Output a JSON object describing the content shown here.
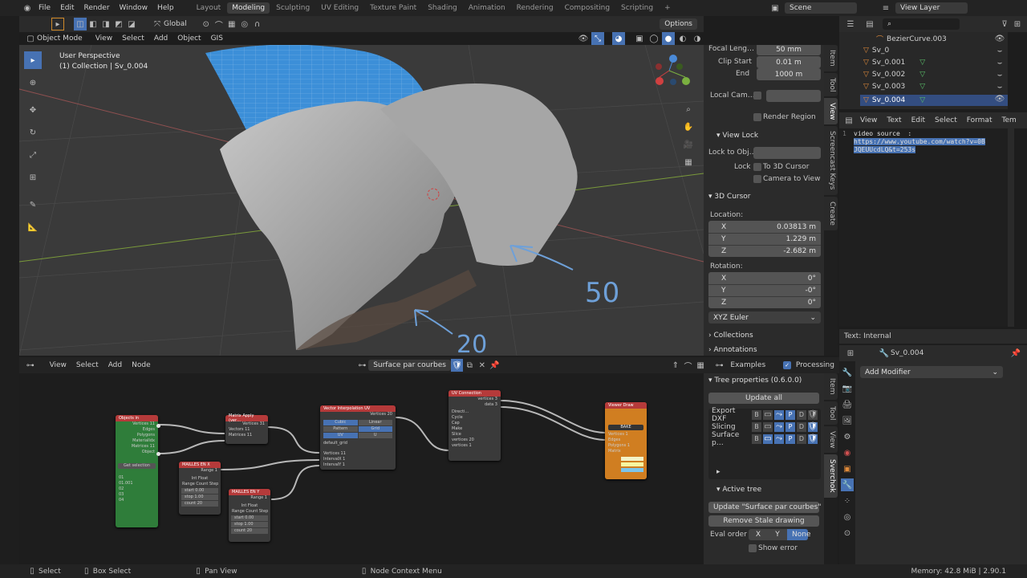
{
  "menu": [
    "File",
    "Edit",
    "Render",
    "Window",
    "Help"
  ],
  "workspaces": [
    "Layout",
    "Modeling",
    "Sculpting",
    "UV Editing",
    "Texture Paint",
    "Shading",
    "Animation",
    "Rendering",
    "Compositing",
    "Scripting"
  ],
  "active_workspace": "Modeling",
  "scene_name": "Scene",
  "view_layer": "View Layer",
  "viewport": {
    "orientation": "Global",
    "mode": "Object Mode",
    "menus": [
      "View",
      "Select",
      "Add",
      "Object",
      "GIS"
    ],
    "options": "Options",
    "overlay_title": "User Perspective",
    "overlay_sub": "(1) Collection | Sv_0.004",
    "annot_50": "50",
    "annot_20": "20"
  },
  "npanel": {
    "tabs": [
      "Item",
      "Tool",
      "View",
      "Screencast Keys",
      "Create"
    ],
    "focal_label": "Focal Leng…",
    "focal_value": "50 mm",
    "clip_start_label": "Clip Start",
    "clip_start_value": "0.01 m",
    "end_label": "End",
    "end_value": "1000 m",
    "local_camera": "Local Cam…",
    "render_region": "Render Region",
    "view_lock": "View Lock",
    "lock_to_obj": "Lock to Obj…",
    "lock": "Lock",
    "to_3d_cursor": "To 3D Cursor",
    "camera_to_view": "Camera to View",
    "cursor_title": "3D Cursor",
    "location": "Location:",
    "loc": [
      {
        "axis": "X",
        "value": "0.03813 m"
      },
      {
        "axis": "Y",
        "value": "1.229 m"
      },
      {
        "axis": "Z",
        "value": "-2.682 m"
      }
    ],
    "rotation": "Rotation:",
    "rot": [
      {
        "axis": "X",
        "value": "0°"
      },
      {
        "axis": "Y",
        "value": "-0°"
      },
      {
        "axis": "Z",
        "value": "0°"
      }
    ],
    "euler": "XYZ Euler",
    "collections": "Collections",
    "annotations": "Annotations"
  },
  "outliner": {
    "items": [
      {
        "name": "BezierCurve.003"
      },
      {
        "name": "Sv_0"
      },
      {
        "name": "Sv_0.001"
      },
      {
        "name": "Sv_0.002"
      },
      {
        "name": "Sv_0.003"
      },
      {
        "name": "Sv_0.004"
      }
    ]
  },
  "text_editor": {
    "menus": [
      "View",
      "Text",
      "Edit",
      "Select",
      "Format",
      "Tem"
    ],
    "line1": "video source  :",
    "line2": "https://www.youtube.com/watch?v=0B",
    "line3": "JQEUUcdLQ&t=253s",
    "footer": "Text: Internal"
  },
  "properties": {
    "object": "Sv_0.004",
    "add_modifier": "Add Modifier"
  },
  "node_editor": {
    "menus": [
      "View",
      "Select",
      "Add",
      "Node"
    ],
    "tree_name": "Surface par courbes",
    "examples": "Examples",
    "processing": "Processing",
    "tree_props": "Tree properties (0.6.0.0)",
    "update_all": "Update all",
    "trees": [
      {
        "name": "Export DXF"
      },
      {
        "name": "Slicing"
      },
      {
        "name": "Surface p…"
      }
    ],
    "tree_flags": [
      "B",
      "P",
      "D"
    ],
    "active_tree": "Active tree",
    "update_tree": "Update \"Surface par courbes\"",
    "remove_stale": "Remove Stale drawing",
    "eval_order": "Eval order",
    "eval_opts": [
      "X",
      "Y",
      "None"
    ],
    "show_error": "Show error",
    "side_tabs": [
      "Item",
      "Tool",
      "View",
      "Sverchok"
    ]
  },
  "nodes": {
    "objects_in": {
      "title": "Objects in",
      "outs": [
        "Vertices 11",
        "Edges",
        "Polygons",
        "MaterialIdx",
        "Matrices 11",
        "Object"
      ],
      "get_selection": "Get selection",
      "items": [
        "01",
        "01.001",
        "02",
        "03",
        "04"
      ]
    },
    "matrix_apply": {
      "title": "Matrix Apply (ver…",
      "outs": [
        "Vertices 31"
      ],
      "ins": [
        "Vectors 11",
        "Matrices 11"
      ]
    },
    "mailles_x": {
      "title": "MAILLES EN X",
      "out": "Range 1",
      "opts": "Int   Float",
      "mode": "Range Count Step",
      "fields": [
        "start 0.00",
        "stop 1.00",
        "count 20"
      ]
    },
    "mailles_y": {
      "title": "MAILLES EN Y",
      "out": "Range 1",
      "opts": "Int   Float",
      "mode": "Range Count Step",
      "fields": [
        "start 0.00",
        "stop 1.00",
        "count 20"
      ]
    },
    "vector_interp": {
      "title": "Vector Interpolation UV",
      "out": "Vertices 20",
      "opts": [
        "Cubic",
        "Linear",
        "Pattern",
        "Grid",
        "UV",
        "U"
      ],
      "extra": "default_grid",
      "ins": [
        "Vertices 11",
        "IntervalX 1",
        "IntervalY 1"
      ]
    },
    "uv_connection": {
      "title": "UV Connection",
      "outs": [
        "vertices 3",
        "data 3"
      ],
      "rows": [
        "Directi…",
        "Cycle",
        "Cap",
        "Make",
        "Slice"
      ],
      "ins": [
        "vertices 20",
        "vertices 1"
      ]
    },
    "viewer_draw": {
      "title": "Viewer Draw",
      "ins": [
        "Vertices 1",
        "Edges",
        "Polygons 1",
        "Matrix"
      ],
      "bake": "BAKE"
    }
  },
  "status": {
    "select": "Select",
    "box_select": "Box Select",
    "pan_view": "Pan View",
    "node_ctx": "Node Context Menu",
    "memory": "Memory: 42.8 MiB | 2.90.1"
  },
  "colors": {
    "accent": "#4772b3",
    "node_green": "#2f7d3a",
    "node_orange": "#d07e21",
    "node_red": "#b53a3a",
    "annot_blue": "#6ea0d8"
  }
}
